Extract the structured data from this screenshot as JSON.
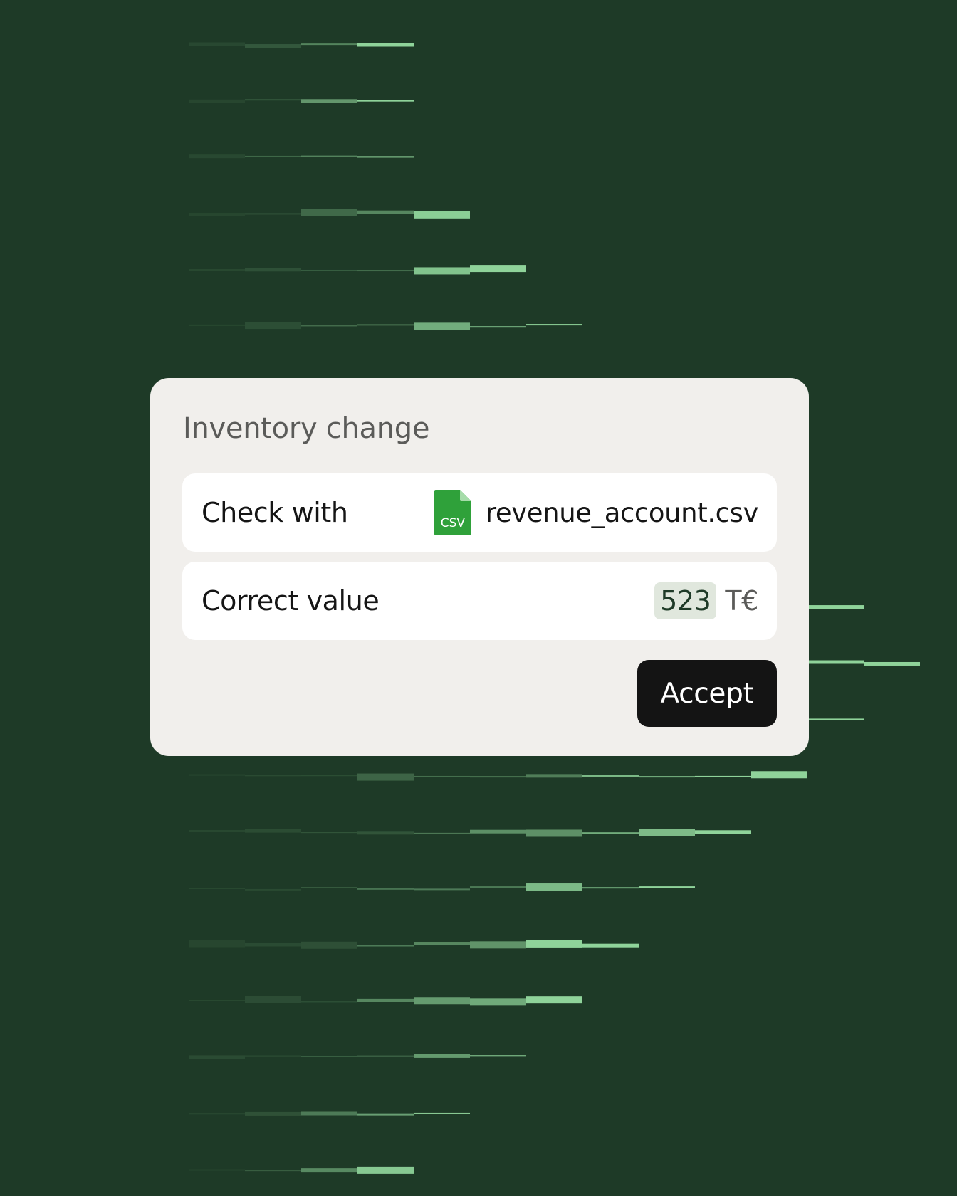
{
  "dialog": {
    "title": "Inventory change",
    "check_row": {
      "label": "Check with",
      "file_icon": "csv-file-icon",
      "file_icon_text": "CSV",
      "file_name": "revenue_account.csv"
    },
    "value_row": {
      "label": "Correct value",
      "value": "523",
      "unit": "T€"
    },
    "accept_label": "Accept"
  },
  "colors": {
    "background": "#1e3a27",
    "card": "#f1efec",
    "csv_icon": "#2fa13a",
    "value_highlight": "#e0e7dd",
    "button": "#141414",
    "stripe_light": "#8fd39a"
  }
}
